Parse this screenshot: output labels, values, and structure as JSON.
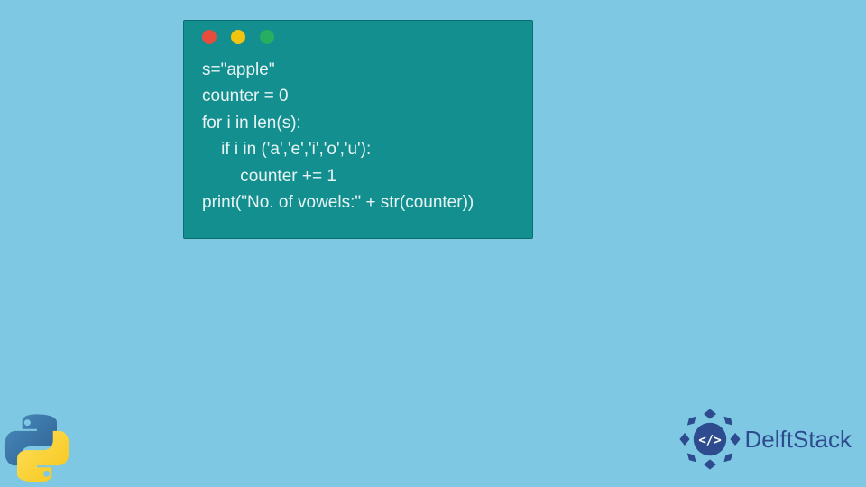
{
  "code": {
    "lines": [
      "s=\"apple\"",
      "counter = 0",
      "for i in len(s):",
      "    if i in ('a','e','i','o','u'):",
      "        counter += 1",
      "print(\"No. of vowels:\" + str(counter))"
    ]
  },
  "brand": {
    "name": "DelftStack"
  },
  "colors": {
    "background": "#7ec8e3",
    "codeWindow": "#148f8f",
    "codeText": "#e8f4f4",
    "dotRed": "#e74c3c",
    "dotYellow": "#f1c40f",
    "dotGreen": "#27ae60",
    "brandBlue": "#2d4b8e"
  }
}
